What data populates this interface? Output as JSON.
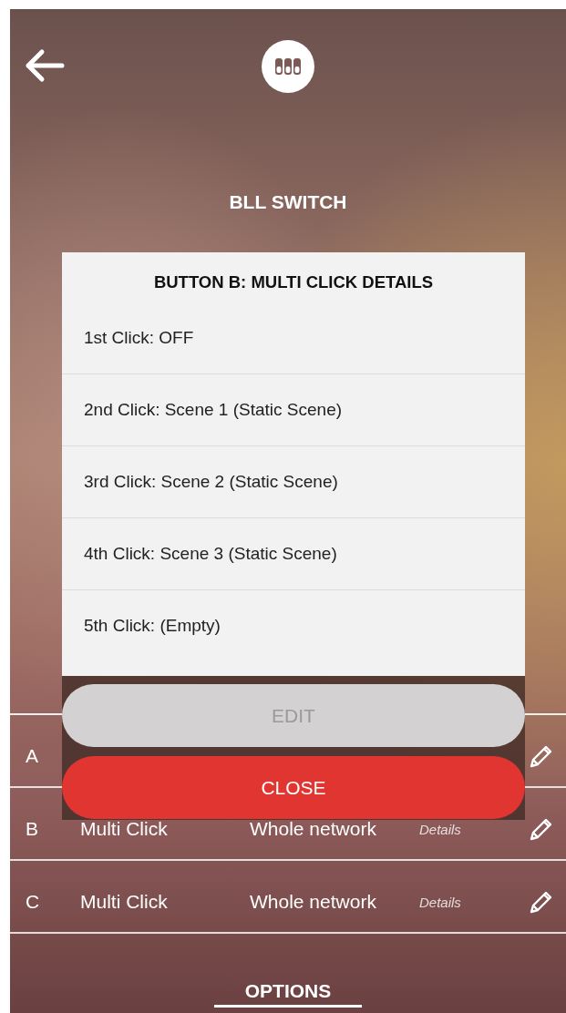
{
  "header": {
    "title": "BLL SWITCH"
  },
  "table": {
    "rows": [
      {
        "button": "A"
      },
      {
        "button": "B",
        "function": "Multi Click",
        "destination": "Whole network",
        "details": "Details"
      },
      {
        "button": "C",
        "function": "Multi Click",
        "destination": "Whole network",
        "details": "Details"
      }
    ]
  },
  "tabs": [
    {
      "label": "OPTIONS",
      "selected": true
    }
  ],
  "dialog": {
    "title": "BUTTON B: MULTI CLICK DETAILS",
    "items": [
      "1st Click: OFF",
      "2nd Click: Scene 1 (Static Scene)",
      "3rd Click: Scene 2 (Static Scene)",
      "4th Click: Scene 3 (Static Scene)",
      "5th Click: (Empty)"
    ],
    "buttons": [
      {
        "label": "EDIT",
        "kind": "secondary",
        "disabled": true
      },
      {
        "label": "CLOSE",
        "kind": "primary",
        "disabled": false
      }
    ]
  }
}
